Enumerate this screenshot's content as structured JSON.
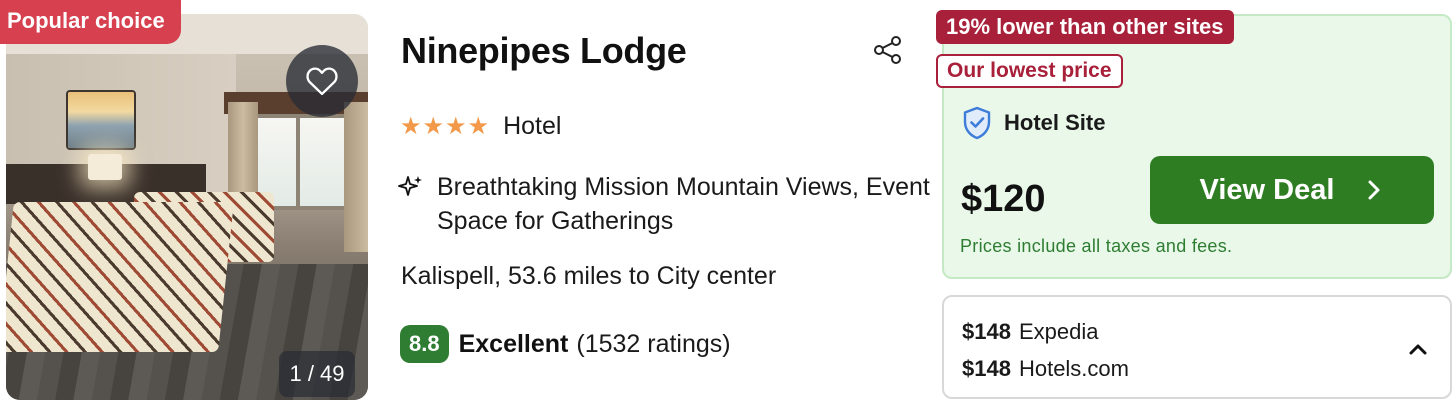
{
  "badge": "Popular choice",
  "photo": {
    "counter": "1 / 49",
    "favorite_icon": "heart-icon"
  },
  "hotel": {
    "name": "Ninepipes Lodge",
    "stars": 4,
    "stars_text": "★★★★",
    "type": "Hotel",
    "features": "Breathtaking Mission Mountain Views, Event Space for Gatherings",
    "location": "Kalispell, 53.6 miles to City center",
    "rating": {
      "score": "8.8",
      "word": "Excellent",
      "count": "(1532 ratings)"
    },
    "share_icon": "share-icon",
    "feature_icon": "sparkle-icon"
  },
  "deal": {
    "tag_lower": "19% lower than other sites",
    "tag_lowest": "Our lowest price",
    "provider": "Hotel Site",
    "provider_icon": "shield-check-icon",
    "price": "$120",
    "button_label": "View Deal",
    "tax_note": "Prices include all taxes and fees."
  },
  "other_offers": [
    {
      "price": "$148",
      "site": "Expedia"
    },
    {
      "price": "$148",
      "site": "Hotels.com"
    }
  ],
  "colors": {
    "popular_badge": "#d6404f",
    "tag_red": "#a8203a",
    "deal_bg": "#e9f8e9",
    "deal_border": "#c4e9c4",
    "button_green": "#2e7d22",
    "score_green": "#2e7d32",
    "star_orange": "#f2994a"
  }
}
